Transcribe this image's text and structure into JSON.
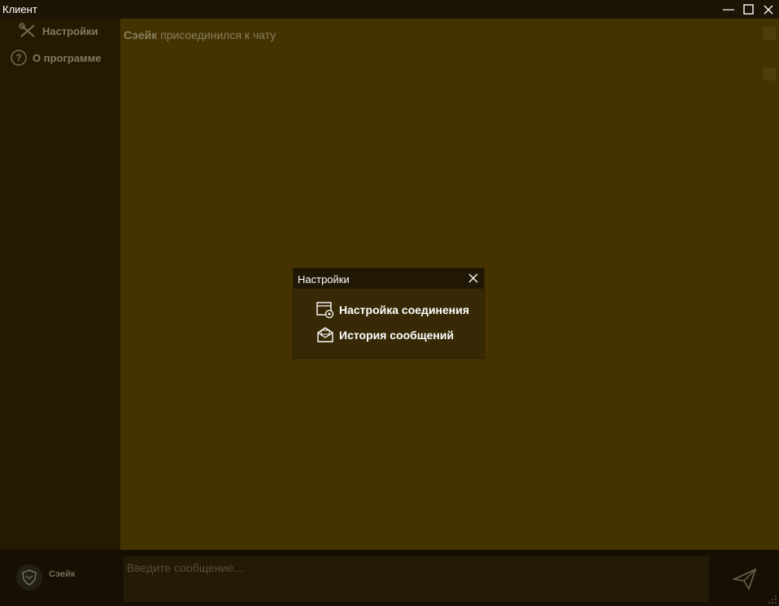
{
  "window": {
    "title": "Клиент"
  },
  "sidebar": {
    "items": [
      {
        "label": "Настройки",
        "icon": "tools-icon"
      },
      {
        "label": "О программе",
        "icon": "help-icon"
      }
    ]
  },
  "chat": {
    "messages": [
      {
        "user": "Сэейк",
        "text": " присоединился к чату"
      }
    ]
  },
  "composer": {
    "user_name": "Сэейк",
    "placeholder": "Введите сообщение..."
  },
  "dialog": {
    "title": "Настройки",
    "items": [
      {
        "label": "Настройка соединения",
        "icon": "connection-settings-icon"
      },
      {
        "label": "История сообщений",
        "icon": "mail-history-icon"
      }
    ]
  },
  "colors": {
    "chat_background": "#6e5300",
    "sidebar_background": "#3a2a04",
    "titlebar_background": "#1c1505",
    "dialog_background": "#372905"
  }
}
